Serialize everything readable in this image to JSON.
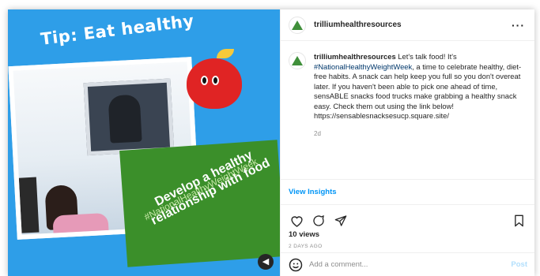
{
  "media": {
    "tip_text": "Tip: Eat healthy",
    "banner_text": "Develop a healthy relationship with food",
    "banner_hashtag": "#NationalHealthyWeightWeek"
  },
  "post": {
    "username": "trilliumhealthresources",
    "menu_icon": "more-options-icon",
    "caption": {
      "username": "trilliumhealthresources",
      "text_before": " Let's talk food! It's ",
      "hashtag": "#NationalHealthyWeightWeek",
      "text_after": ", a time to celebrate healthy, diet-free habits. A snack can help keep you full so you don't overeat later. If you haven't been able to pick one ahead of time, sensABLE snacks food trucks make grabbing a healthy snack easy. Check them out using the link below! https://sensablesnacksesucp.square.site/",
      "age": "2d"
    },
    "insights_label": "View Insights",
    "views": "10 views",
    "date": "2 DAYS AGO",
    "comment": {
      "placeholder": "Add a comment...",
      "post_label": "Post"
    }
  },
  "colors": {
    "accent": "#0095f6",
    "media_bg": "#2e9ee8",
    "banner_green": "#3b8f2a"
  }
}
